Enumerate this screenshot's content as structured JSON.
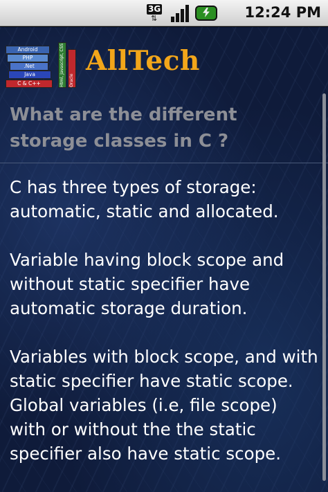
{
  "status_bar": {
    "network_label": "3G",
    "time": "12:24 PM"
  },
  "header": {
    "brand": "AllTech",
    "logo_books": [
      "C & C++",
      "Java",
      ".Net",
      "PHP",
      "Android"
    ],
    "logo_vertical_books": [
      "Html, Javascript, CSS",
      "Oracle"
    ]
  },
  "question": "What are the different storage classes in C ?",
  "answer": {
    "paragraphs": [
      "C has three types of storage: automatic, static and allocated.",
      "Variable having block scope and without static specifier have automatic storage duration.",
      "Variables with block scope, and with static specifier have static scope. Global variables (i.e, file scope) with or without the the static specifier also have static scope."
    ]
  },
  "colors": {
    "brand": "#f2a61a",
    "question_text": "#8d8f96",
    "answer_text": "#ffffff",
    "background": "#0f1b3a"
  },
  "icons": [
    "3g-icon",
    "signal-icon",
    "battery-charging-icon"
  ]
}
